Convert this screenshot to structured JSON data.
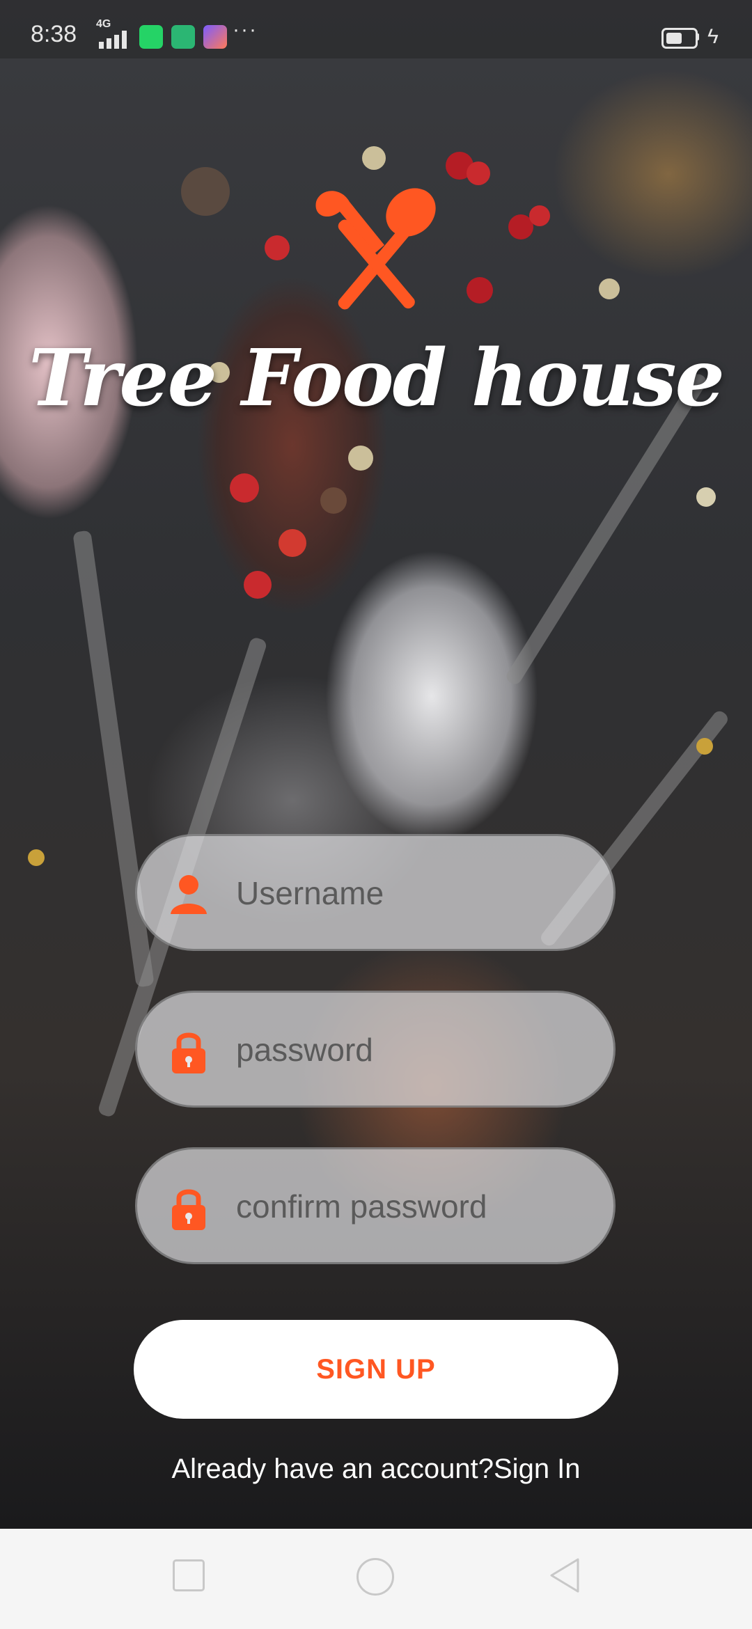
{
  "status_bar": {
    "time": "8:38",
    "network": "4G",
    "more": "···"
  },
  "brand": {
    "name": "Tree Food house",
    "accent_color": "#ff5722",
    "logo_icon": "crossed-spoon-fork-icon"
  },
  "form": {
    "username": {
      "placeholder": "Username",
      "value": "",
      "icon": "person-icon"
    },
    "password": {
      "placeholder": "password",
      "value": "",
      "icon": "lock-icon"
    },
    "confirm_password": {
      "placeholder": "confirm password",
      "value": "",
      "icon": "lock-icon"
    },
    "signup_label": "SIGN UP",
    "signin_prompt": "Already have an account?",
    "signin_link": "Sign In"
  },
  "nav_bar": {
    "icons": [
      "recents-icon",
      "home-icon",
      "back-icon"
    ]
  }
}
